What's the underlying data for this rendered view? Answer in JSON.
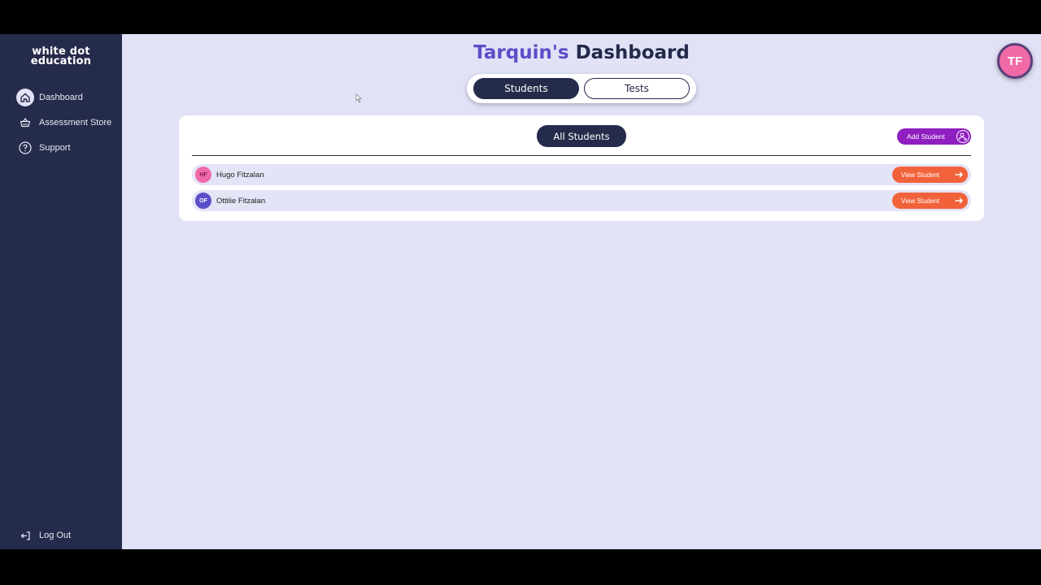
{
  "brand": {
    "line1": "white dot",
    "line2": "education"
  },
  "sidebar": {
    "items": [
      {
        "label": "Dashboard",
        "icon": "home-icon",
        "active": true
      },
      {
        "label": "Assessment Store",
        "icon": "basket-icon",
        "active": false
      },
      {
        "label": "Support",
        "icon": "question-icon",
        "active": false
      }
    ],
    "logout_label": "Log Out"
  },
  "header": {
    "name": "Tarquin's",
    "title_rest": "Dashboard",
    "user_initials": "TF"
  },
  "tabs": {
    "students": "Students",
    "tests": "Tests",
    "active": "students"
  },
  "panel": {
    "heading": "All Students",
    "add_label": "Add Student",
    "students": [
      {
        "initials": "HF",
        "name": "Hugo Fitzalan",
        "action": "View Student"
      },
      {
        "initials": "OF",
        "name": "Ottilie Fitzalan",
        "action": "View Student"
      }
    ]
  },
  "colors": {
    "sidebar": "#252b4a",
    "background": "#e1e2f6",
    "accent_name": "#5a4fc8",
    "add_button": "#8f1fc0",
    "view_button": "#f2623a",
    "avatar_hf": "#f06aa8",
    "avatar_of": "#5a4fc8",
    "avatar_user": "#f06aa8"
  }
}
